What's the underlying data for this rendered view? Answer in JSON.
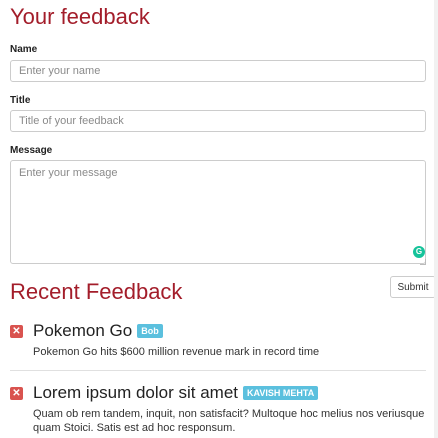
{
  "form": {
    "heading": "Your feedback",
    "name_label": "Name",
    "name_placeholder": "Enter your name",
    "title_label": "Title",
    "title_placeholder": "Title of your feedback",
    "message_label": "Message",
    "message_placeholder": "Enter your message",
    "submit_label": "Submit"
  },
  "recent": {
    "heading": "Recent Feedback",
    "items": [
      {
        "title": "Pokemon Go",
        "author": "Bob",
        "body": "Pokemon Go hits $600 million revenue mark in record time"
      },
      {
        "title": "Lorem ipsum dolor sit amet",
        "author": "KAVISH MEHTA",
        "body": "Quam ob rem tandem, inquit, non satisfacit? Multoque hoc melius nos veriusque quam Stoici. Satis est ad hoc responsum."
      }
    ]
  },
  "icons": {
    "delete": "close-icon",
    "grammarly": "grammarly-icon"
  },
  "colors": {
    "heading": "#a31d2a",
    "badge": "#5bc0de",
    "delete": "#d9534f",
    "grammarly": "#15c39a"
  }
}
